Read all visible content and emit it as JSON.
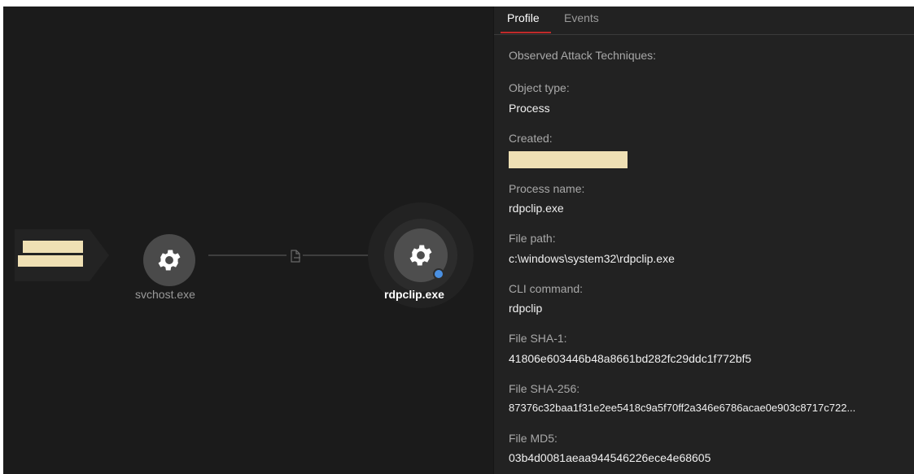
{
  "graph": {
    "nodes": [
      {
        "label": "svchost.exe",
        "icon": "gear-icon"
      },
      {
        "label": "rdpclip.exe",
        "icon": "gear-icon",
        "status_dot_color": "#4a90e2"
      }
    ],
    "edge_icon": "file-icon",
    "redaction_color": "#efe0b4"
  },
  "panel": {
    "tabs": [
      {
        "label": "Profile",
        "active": true
      },
      {
        "label": "Events",
        "active": false
      }
    ],
    "accent_color": "#c12a2a",
    "section_heading": "Observed Attack Techniques:",
    "fields": {
      "object_type": {
        "label": "Object type:",
        "value": "Process"
      },
      "created": {
        "label": "Created:"
      },
      "process_name": {
        "label": "Process name:",
        "value": "rdpclip.exe"
      },
      "file_path": {
        "label": "File path:",
        "value": "c:\\windows\\system32\\rdpclip.exe"
      },
      "cli_command": {
        "label": "CLI command:",
        "value": "rdpclip"
      },
      "sha1": {
        "label": "File SHA-1:",
        "value": "41806e603446b48a8661bd282fc29ddc1f772bf5"
      },
      "sha256": {
        "label": "File SHA-256:",
        "value": "87376c32baa1f31e2ee5418c9a5f70ff2a346e6786acae0e903c8717c722..."
      },
      "md5": {
        "label": "File MD5:",
        "value": "03b4d0081aeaa944546226ece4e68605"
      }
    }
  }
}
